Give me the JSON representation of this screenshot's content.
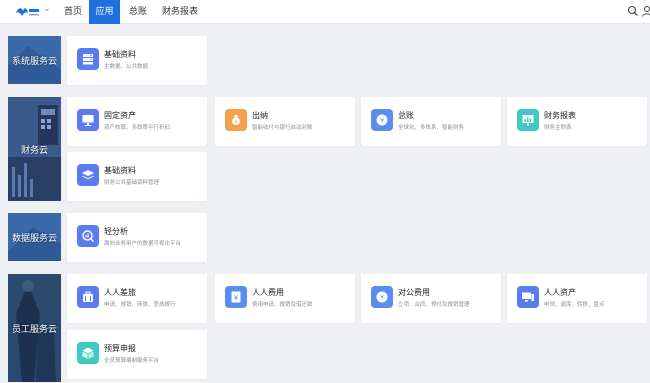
{
  "nav": {
    "home": "首页",
    "apps": "应用",
    "ledger": "总账",
    "reports": "财务报表"
  },
  "icons": {
    "logo": "yonyou-logo",
    "dropdown": "chevron-down-icon",
    "search": "search-icon",
    "user": "user-icon"
  },
  "categories": [
    {
      "id": "system",
      "label": "系统服务云",
      "color": "#2f5f9e"
    },
    {
      "id": "finance",
      "label": "财务云",
      "color": "#324a78"
    },
    {
      "id": "data",
      "label": "数据服务云",
      "color": "#2f5f9e"
    },
    {
      "id": "staff",
      "label": "员工服务云",
      "color": "#25405f"
    }
  ],
  "cards": {
    "sys_basic": {
      "title": "基础资料",
      "desc": "主数据、公共数据",
      "icon": "server-icon",
      "color": "#5b7cf0"
    },
    "fixed_assets": {
      "title": "固定资产",
      "desc": "资产核算、多政策平行折旧",
      "icon": "monitor-icon",
      "color": "#5b7cf0"
    },
    "cashier": {
      "title": "出纳",
      "desc": "智能收付与银行自动对账",
      "icon": "money-bag-icon",
      "color": "#f5a04a"
    },
    "gl": {
      "title": "总账",
      "desc": "全球化、多体系、智能财务",
      "icon": "ledger-icon",
      "color": "#5b8df0"
    },
    "fin_report": {
      "title": "财务报表",
      "desc": "财务主附表",
      "icon": "report-icon",
      "color": "#3fc9c0"
    },
    "fin_basic": {
      "title": "基础资料",
      "desc": "财务公共基础资料管理",
      "icon": "layers-icon",
      "color": "#5b7cf0"
    },
    "analysis": {
      "title": "轻分析",
      "desc": "面向业务用户的数据可视化平台",
      "icon": "chart-search-icon",
      "color": "#5b7cf0"
    },
    "travel": {
      "title": "人人差旅",
      "desc": "申请、报销、商旅、差旅报行",
      "icon": "travel-icon",
      "color": "#5b7cf0"
    },
    "expense": {
      "title": "人人费用",
      "desc": "费用申请、报销及借还款",
      "icon": "yen-icon",
      "color": "#5b8df0"
    },
    "corp_expense": {
      "title": "对公费用",
      "desc": "立项、合同、预付及报销管理",
      "icon": "corporate-icon",
      "color": "#5b8df0"
    },
    "assets": {
      "title": "人人资产",
      "desc": "申领、退库、转移、盘点",
      "icon": "screen-icon",
      "color": "#5b7cf0"
    },
    "budget": {
      "title": "预算申报",
      "desc": "全员预算编制服务平台",
      "icon": "cube-icon",
      "color": "#3fc9c0"
    }
  }
}
